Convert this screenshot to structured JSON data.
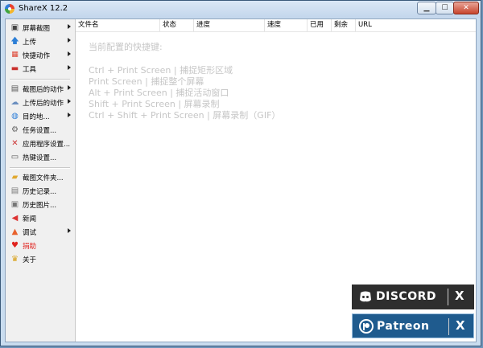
{
  "window": {
    "title": "ShareX 12.2"
  },
  "sidebar": {
    "items": [
      {
        "label": "屏幕截图",
        "icon": "camera-icon",
        "submenu": true
      },
      {
        "label": "上传",
        "icon": "upload-arrow-icon",
        "submenu": true
      },
      {
        "label": "快捷动作",
        "icon": "grid-icon",
        "submenu": true
      },
      {
        "label": "工具",
        "icon": "toolbox-icon",
        "submenu": true
      },
      {
        "label": "截图后的动作",
        "icon": "image-actions-icon",
        "submenu": true
      },
      {
        "label": "上传后的动作",
        "icon": "cloud-upload-icon",
        "submenu": true
      },
      {
        "label": "目的地...",
        "icon": "globe-icon",
        "submenu": true
      },
      {
        "label": "任务设置...",
        "icon": "gear-icon",
        "submenu": false
      },
      {
        "label": "应用程序设置...",
        "icon": "wrench-icon",
        "submenu": false
      },
      {
        "label": "热键设置...",
        "icon": "keyboard-icon",
        "submenu": false
      },
      {
        "label": "截图文件夹...",
        "icon": "folder-icon",
        "submenu": false
      },
      {
        "label": "历史记录...",
        "icon": "history-icon",
        "submenu": false
      },
      {
        "label": "历史图片...",
        "icon": "image-history-icon",
        "submenu": false
      },
      {
        "label": "新闻",
        "icon": "megaphone-icon",
        "submenu": false
      },
      {
        "label": "调试",
        "icon": "warning-cone-icon",
        "submenu": true
      },
      {
        "label": "捐助",
        "icon": "heart-icon",
        "submenu": false
      },
      {
        "label": "关于",
        "icon": "crown-icon",
        "submenu": false
      }
    ]
  },
  "list": {
    "columns": [
      "文件名",
      "状态",
      "进度",
      "速度",
      "已用",
      "剩余",
      "URL"
    ]
  },
  "hints": {
    "title": "当前配置的快捷键:",
    "lines": [
      "Ctrl + Print Screen  |  捕捉矩形区域",
      "Print Screen  |  捕捉整个屏幕",
      "Alt + Print Screen  |  捕捉活动窗口",
      "Shift + Print Screen  |  屏幕录制",
      "Ctrl + Shift + Print Screen  |  屏幕录制（GIF）"
    ]
  },
  "promos": {
    "discord": {
      "label": "DISCORD",
      "close": "X"
    },
    "patreon": {
      "label": "Patreon",
      "close": "X"
    }
  },
  "colors": {
    "accent_red": "#e0231f",
    "discord_bg": "#2e2e2e",
    "patreon_bg": "#1f5b8e"
  }
}
